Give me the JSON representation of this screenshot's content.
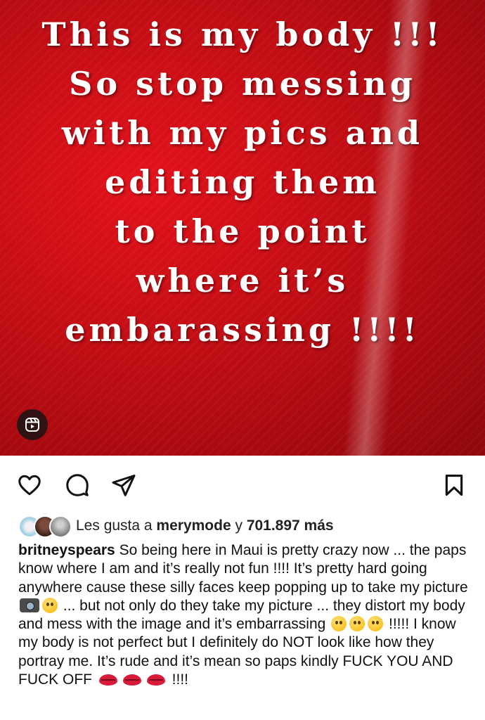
{
  "post": {
    "image_text": [
      "This is my body !!!",
      "So stop messing",
      "with my pics and",
      "editing them",
      "to the point",
      "where it’s",
      "embarassing !!!!"
    ],
    "reel_icon": "reels-icon",
    "background_color": "#d0101a"
  },
  "actions": {
    "like_icon": "heart-icon",
    "comment_icon": "comment-icon",
    "share_icon": "send-icon",
    "save_icon": "bookmark-icon"
  },
  "likes": {
    "prefix": "Les gusta a ",
    "user": "merymode",
    "connector": " y ",
    "count": "701.897 más"
  },
  "caption": {
    "username": "britneyspears",
    "part1": " So being here in Maui is pretty crazy now ... the paps know where I am and it’s really not fun !!!! It’s pretty hard going anywhere cause these silly faces keep popping up to take my picture ",
    "part2": " ... but not only do they take my picture ... they distort my body and mess with the image and it’s embarrassing ",
    "part3": " !!!!! I know my body is not perfect but I definitely do NOT look like how they portray me. It’s rude and it’s mean so paps kindly FUCK YOU AND FUCK OFF ",
    "part4": " !!!!"
  }
}
